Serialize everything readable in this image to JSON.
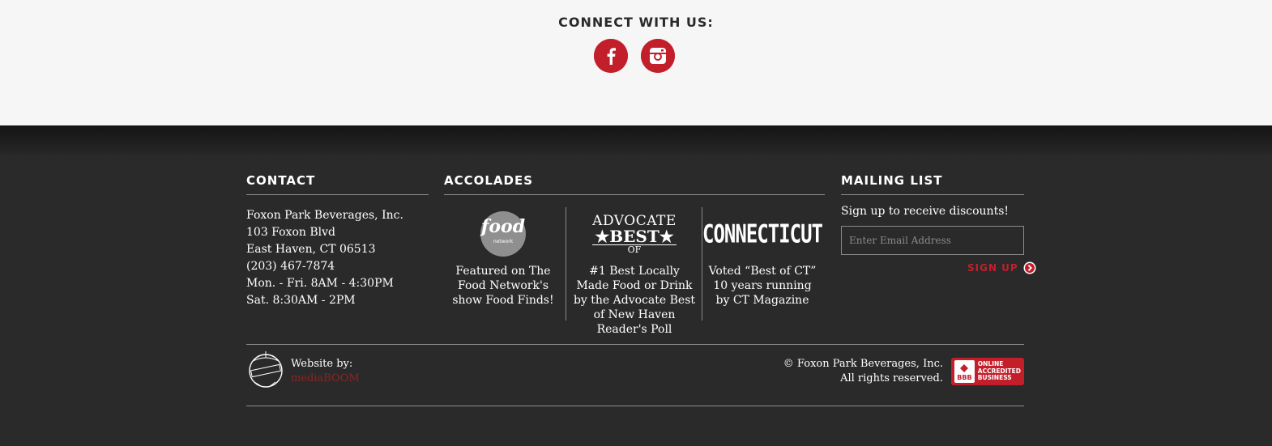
{
  "connect": {
    "title": "CONNECT WITH US:",
    "icons": [
      "facebook-icon",
      "instagram-icon"
    ]
  },
  "colors": {
    "accent": "#c21f2b",
    "footer_bg": "#2a2a2a",
    "top_bg": "#f6f6f6",
    "link_dark_red": "#8c2424"
  },
  "contact": {
    "heading": "CONTACT",
    "lines": [
      "Foxon Park Beverages, Inc.",
      "103 Foxon Blvd",
      "East Haven, CT 06513",
      "(203) 467-7874",
      "Mon. - Fri. 8AM - 4:30PM",
      "Sat. 8:30AM - 2PM"
    ]
  },
  "accolades": {
    "heading": "ACCOLADES",
    "items": [
      {
        "logo": {
          "word": "food",
          "sub": "network"
        },
        "text": "Featured on The Food Network's show Food Finds!"
      },
      {
        "logo": {
          "line1": "ADVOCATE",
          "line2": "★BEST★",
          "line3": "OF"
        },
        "text": "#1 Best Locally Made Food or Drink by the Advocate Best of New Haven Reader's Poll"
      },
      {
        "logo": {
          "word": "CONNECTICUT"
        },
        "text": "Voted “Best of CT” 10 years running by CT Magazine"
      }
    ]
  },
  "mailing": {
    "heading": "MAILING LIST",
    "description": "Sign up to receive discounts!",
    "email_placeholder": "Enter Email Address",
    "email_value": "",
    "signup_label": "SIGN UP"
  },
  "footer": {
    "website_by": "Website by:",
    "agency": "mediaBOOM",
    "copyright_line1": "© Foxon Park Beverages, Inc.",
    "copyright_line2": "All rights reserved.",
    "bbb": {
      "seal": "BBB",
      "line1": "ONLINE",
      "line2": "ACCREDITED",
      "line3": "BUSINESS"
    }
  }
}
